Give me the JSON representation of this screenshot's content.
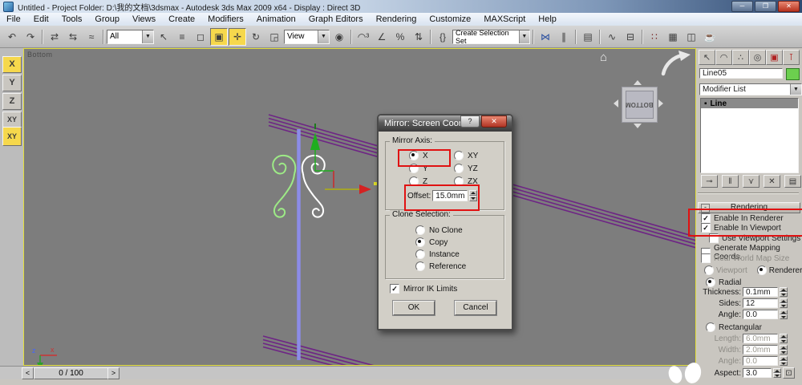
{
  "title_bar": {
    "title": "Untitled   - Project Folder: D:\\我的文档\\3dsmax   - Autodesk 3ds Max  2009 x64   - Display : Direct 3D",
    "minimize": "─",
    "maximize": "❐",
    "close": "✕"
  },
  "menu": {
    "items": [
      "File",
      "Edit",
      "Tools",
      "Group",
      "Views",
      "Create",
      "Modifiers",
      "Animation",
      "Graph Editors",
      "Rendering",
      "Customize",
      "MAXScript",
      "Help"
    ]
  },
  "toolbar": {
    "selection_filter_value": "All",
    "coord_system_value": "View",
    "named_sets_value": "Create Selection Set",
    "glyphs": {
      "undo": "↶",
      "redo": "↷",
      "link": "⇄",
      "unlink": "⇆",
      "bind": "≈",
      "select": "↖",
      "select_by_name": "≡",
      "region": "◻",
      "window_crossing": "▣",
      "move": "✛",
      "rotate": "↻",
      "scale": "◲",
      "center": "◉",
      "snap": "◠³",
      "angle_snap": "∠",
      "percent_snap": "%",
      "spinner_snap": "⇅",
      "named_sets": "{}",
      "mirror": "⋈",
      "align": "∥",
      "layers": "▤",
      "curve_editor": "∿",
      "schematic": "⊟",
      "material": "∷",
      "render_setup": "▦",
      "render_frame": "◫",
      "render": "☕"
    }
  },
  "axis_constraints": {
    "x": "X",
    "y": "Y",
    "z": "Z",
    "xy": "XY",
    "xy2": "XY"
  },
  "viewport": {
    "label": "Bottom",
    "viewcube": "BOTTOM",
    "axis_x": "x",
    "axis_z": "z",
    "home": "⌂"
  },
  "mirror_dialog": {
    "title": "Mirror: Screen Coor...",
    "help_button": "?",
    "close_button": "✕",
    "axis_group": "Mirror Axis:",
    "axis_options": [
      "X",
      "Y",
      "Z",
      "XY",
      "YZ",
      "ZX"
    ],
    "selected_axis": "X",
    "offset_label": "Offset:",
    "offset_value": "15.0mm",
    "clone_group": "Clone Selection:",
    "clone_options": [
      "No Clone",
      "Copy",
      "Instance",
      "Reference"
    ],
    "selected_clone": "Copy",
    "ik_checkbox_label": "Mirror IK Limits",
    "ik_checked": "✓",
    "ok": "OK",
    "cancel": "Cancel"
  },
  "command_panel": {
    "object_name": "Line05",
    "modifier_list_label": "Modifier List",
    "stack_item": "Line",
    "stack_item_bullet": "▪",
    "rendering": {
      "header": "Rendering",
      "collapse": "-",
      "enable_in_renderer": "Enable In Renderer",
      "enable_in_viewport": "Enable In Viewport",
      "use_viewport_settings": "Use Viewport Settings",
      "generate_mapping_coords": "Generate Mapping Coords.",
      "real_world_map_size": "Real-World Map Size",
      "viewport_option": "Viewport",
      "renderer_option": "Renderer",
      "radial_option": "Radial",
      "thickness_label": "Thickness:",
      "thickness_value": "0.1mm",
      "sides_label": "Sides:",
      "sides_value": "12",
      "angle_label": "Angle:",
      "angle_value": "0.0",
      "rectangular_option": "Rectangular",
      "length_label": "Length:",
      "length_value": "6.0mm",
      "width_label": "Width:",
      "width_value": "2.0mm",
      "angle2_label": "Angle:",
      "angle2_value": "0.0",
      "aspect_label": "Aspect:",
      "aspect_value": "3.0",
      "checked": "✓"
    }
  },
  "timeline": {
    "prev": "<",
    "value": "0 / 100",
    "next": ">"
  },
  "colors": {
    "annotation_red": "#e01212",
    "active_yellow": "#f6d84c",
    "object_color": "#6ccf4e"
  }
}
